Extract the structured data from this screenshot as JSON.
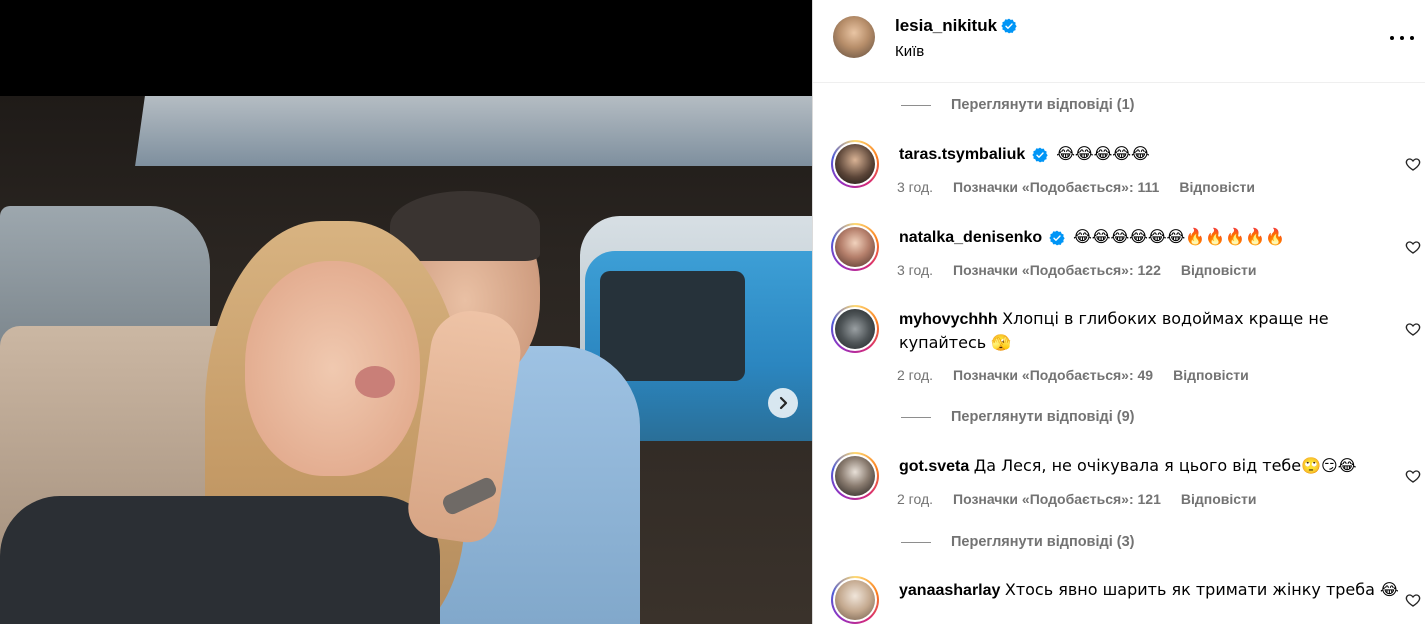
{
  "post": {
    "username": "lesia_nikituk",
    "location": "Київ"
  },
  "comments": [
    {
      "type": "view_replies",
      "label": "Переглянути відповіді (1)"
    },
    {
      "type": "comment",
      "username": "taras.tsymbaliuk",
      "verified": true,
      "text": "😂😂😂😂😂",
      "time": "3 год.",
      "likes": "Позначки «Подобається»: 111",
      "reply": "Відповісти"
    },
    {
      "type": "comment",
      "username": "natalka_denisenko",
      "verified": true,
      "text": "😂😂😂😂😂😂🔥🔥🔥🔥🔥",
      "time": "3 год.",
      "likes": "Позначки «Подобається»: 122",
      "reply": "Відповісти"
    },
    {
      "type": "comment",
      "username": "myhovychhh",
      "verified": false,
      "text": "Хлопці в глибоких водоймах краще не купайтесь 🫣",
      "time": "2 год.",
      "likes": "Позначки «Подобається»: 49",
      "reply": "Відповісти"
    },
    {
      "type": "view_replies",
      "label": "Переглянути відповіді (9)"
    },
    {
      "type": "comment",
      "username": "got.sveta",
      "verified": false,
      "text": "Да Леся, не очікувала я цього від тебе🙄😏😂",
      "time": "2 год.",
      "likes": "Позначки «Подобається»: 121",
      "reply": "Відповісти"
    },
    {
      "type": "view_replies",
      "label": "Переглянути відповіді (3)"
    },
    {
      "type": "comment",
      "username": "yanaasharlay",
      "verified": false,
      "text": "Хтось явно шарить як тримати жінку треба 😂"
    }
  ],
  "colors": {
    "verified": "#0095f6",
    "muted": "#737373",
    "border": "#dbdbdb"
  },
  "icons": {
    "next": "chevron-right-icon",
    "more": "more-options-icon",
    "like": "heart-icon",
    "verified": "verified-badge-icon"
  }
}
